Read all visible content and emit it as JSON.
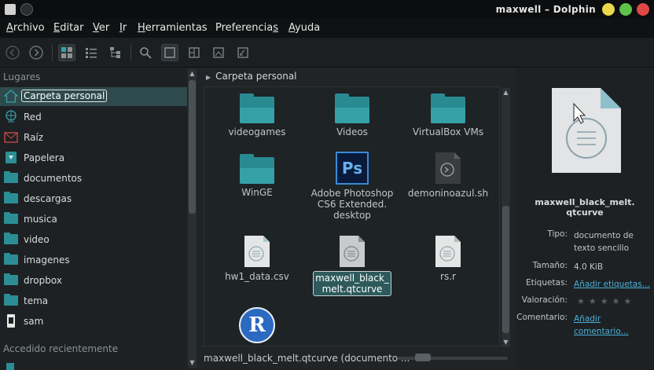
{
  "window": {
    "title": "maxwell – Dolphin",
    "controls": {
      "minimize_color": "#e8d84a",
      "maximize_color": "#5ec24a",
      "close_color": "#e04848"
    }
  },
  "menu": {
    "items": [
      {
        "label": "Archivo",
        "ul": "A",
        "rest": "rchivo"
      },
      {
        "label": "Editar",
        "ul": "E",
        "rest": "ditar"
      },
      {
        "label": "Ver",
        "ul": "V",
        "rest": "er"
      },
      {
        "label": "Ir",
        "ul": "I",
        "rest": "r"
      },
      {
        "label": "Herramientas",
        "ul": "H",
        "rest": "erramientas"
      },
      {
        "label": "Preferencias",
        "ul": "Preferencia",
        "rest": "s"
      },
      {
        "label": "Ayuda",
        "ul": "A",
        "rest": "yuda"
      }
    ]
  },
  "sidebar": {
    "places_header": "Lugares",
    "items": [
      {
        "label": "Carpeta personal",
        "icon": "home-icon",
        "selected": true
      },
      {
        "label": "Red",
        "icon": "network-icon"
      },
      {
        "label": "Raíz",
        "icon": "root-icon"
      },
      {
        "label": "Papelera",
        "icon": "trash-icon"
      },
      {
        "label": "documentos",
        "icon": "folder-icon"
      },
      {
        "label": "descargas",
        "icon": "folder-icon"
      },
      {
        "label": "musica",
        "icon": "folder-icon"
      },
      {
        "label": "video",
        "icon": "folder-icon"
      },
      {
        "label": "imagenes",
        "icon": "folder-icon"
      },
      {
        "label": "dropbox",
        "icon": "folder-icon"
      },
      {
        "label": "tema",
        "icon": "folder-icon"
      },
      {
        "label": "sam",
        "icon": "device-icon"
      }
    ],
    "recent_header": "Accedido recientemente"
  },
  "breadcrumb": {
    "label": "Carpeta personal"
  },
  "files": [
    {
      "name": "videogames",
      "type": "folder"
    },
    {
      "name": "Videos",
      "type": "folder"
    },
    {
      "name": "VirtualBox VMs",
      "type": "folder"
    },
    {
      "name": "WinGE",
      "type": "folder"
    },
    {
      "name": "Adobe Photoshop CS6 Extended.desktop",
      "line1": "Adobe Photoshop",
      "line2": "CS6 Extended.",
      "line3": "desktop",
      "type": "photoshop",
      "icon_text": "Ps"
    },
    {
      "name": "demoninoazul.sh",
      "type": "script"
    },
    {
      "name": "hw1_data.csv",
      "type": "text"
    },
    {
      "name": "maxwell_black_melt.qtcurve",
      "line1": "maxwell_black_",
      "line2": "melt.qtcurve",
      "type": "text",
      "selected": true
    },
    {
      "name": "rs.r",
      "type": "text"
    },
    {
      "name": "R",
      "type": "r",
      "icon_text": "R"
    }
  ],
  "status": {
    "text": "maxwell_black_melt.qtcurve (documento ..."
  },
  "info": {
    "name_line1": "maxwell_black_melt.",
    "name_line2": "qtcurve",
    "type_key": "Tipo:",
    "type_value": "documento de texto sencillo",
    "size_key": "Tamaño:",
    "size_value": "4.0 KiB",
    "tags_key": "Etiquetas:",
    "tags_value": "Añadir etiquetas...",
    "rating_key": "Valoración:",
    "rating_stars": 0,
    "comment_key": "Comentario:",
    "comment_value": "Añadir comentario..."
  }
}
